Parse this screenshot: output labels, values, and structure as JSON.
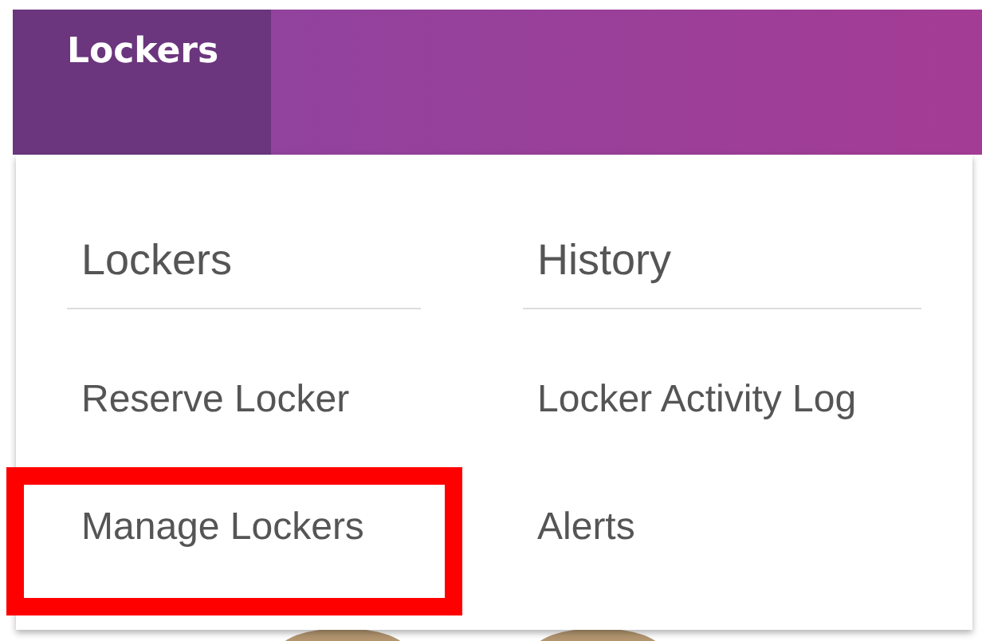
{
  "nav": {
    "tabs": [
      {
        "label": "Lockers",
        "selected": true
      }
    ]
  },
  "dropdown": {
    "columns": [
      {
        "heading": "Lockers",
        "items": [
          {
            "label": "Reserve Locker",
            "highlighted": false
          },
          {
            "label": "Manage Lockers",
            "highlighted": true
          }
        ]
      },
      {
        "heading": "History",
        "items": [
          {
            "label": "Locker Activity Log",
            "highlighted": false
          },
          {
            "label": "Alerts",
            "highlighted": false
          }
        ]
      }
    ]
  }
}
